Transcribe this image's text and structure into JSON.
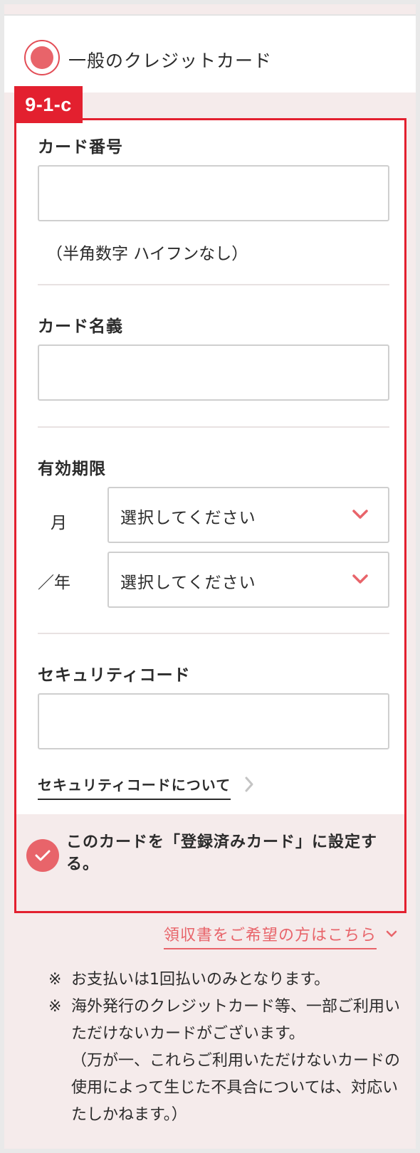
{
  "payment_option": {
    "label": "一般のクレジットカード",
    "selected": true
  },
  "tag": "9-1-c",
  "card_number": {
    "label": "カード番号",
    "value": "",
    "hint": "（半角数字 ハイフンなし）"
  },
  "card_name": {
    "label": "カード名義",
    "value": ""
  },
  "expiry": {
    "label": "有効期限",
    "month_label": "月",
    "year_label": "／年",
    "month_value": "選択してください",
    "year_value": "選択してください"
  },
  "security": {
    "label": "セキュリティコード",
    "value": "",
    "link": "セキュリティコードについて"
  },
  "register": {
    "text": "このカードを「登録済みカード」に設定する。",
    "checked": true
  },
  "receipt_link": "領収書をご希望の方はこちら",
  "notes": {
    "mark": "※",
    "line1": "お支払いは1回払いのみとなります。",
    "line2": "海外発行のクレジットカード等、一部ご利用いただけないカードがございます。",
    "line3": "（万が一、これらご利用いただけないカードの使用によって生じた不具合については、対応いたしかねます。）"
  },
  "colors": {
    "accent": "#e8646a",
    "tag_red": "#e3202f",
    "band": "#f5ebeb"
  },
  "icons": {
    "select_arrow": "chevron-down-icon",
    "link_arrow": "chevron-right-icon",
    "checkbox": "check-icon"
  }
}
